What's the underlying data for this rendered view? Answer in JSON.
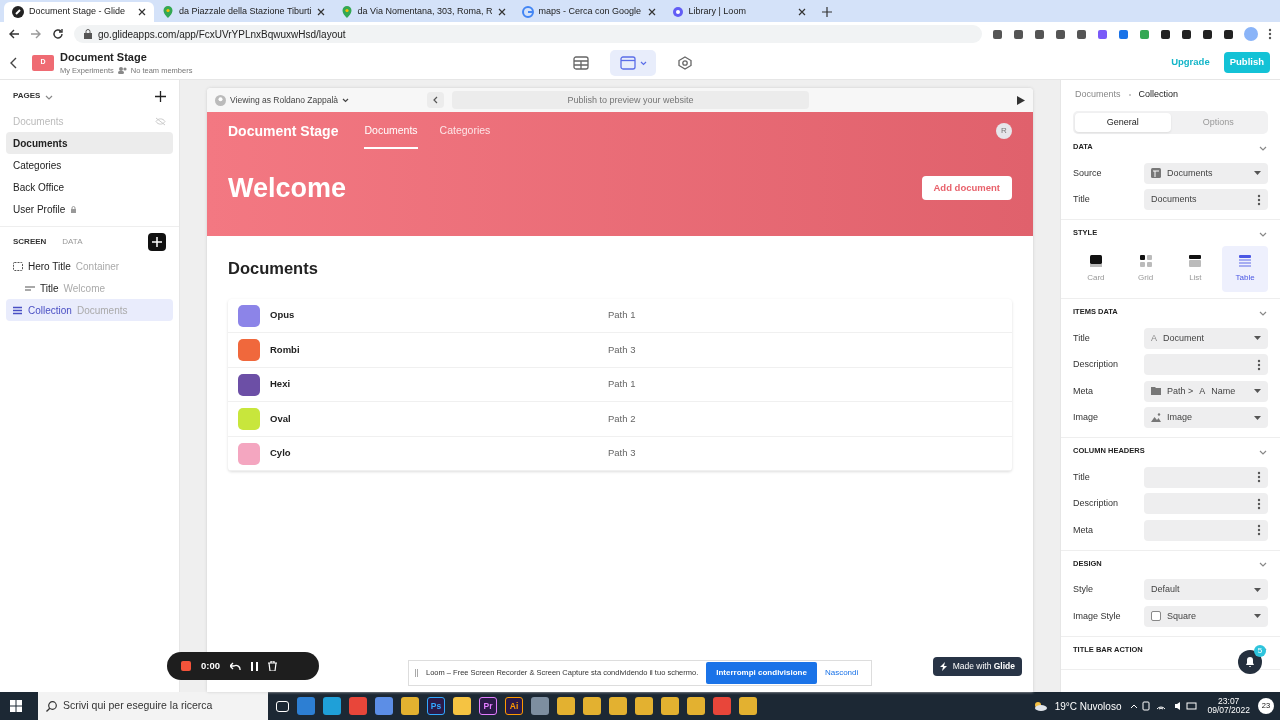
{
  "browser": {
    "tabs": [
      {
        "title": "Document Stage - Glide",
        "kind": "glide",
        "selected": true
      },
      {
        "title": "da Piazzale della Stazione Tiburti",
        "kind": "maps",
        "selected": false
      },
      {
        "title": "da Via Nomentana, 303, Roma, R",
        "kind": "maps",
        "selected": false
      },
      {
        "title": "maps - Cerca con Google",
        "kind": "google",
        "selected": false
      },
      {
        "title": "Library | Loom",
        "kind": "loom",
        "selected": false
      }
    ],
    "url": "go.glideapps.com/app/FcxUVrYPLnxBqwuxwHsd/layout"
  },
  "app_header": {
    "avatar_letter": "D",
    "title": "Document Stage",
    "subtitle": "My Experiments",
    "team": "No team members",
    "upgrade": "Upgrade",
    "publish": "Publish",
    "views": [
      {
        "kind": "data",
        "selected": false
      },
      {
        "kind": "layout",
        "selected": true
      },
      {
        "kind": "settings",
        "selected": false
      }
    ]
  },
  "pages": {
    "heading": "PAGES",
    "items": [
      {
        "label": "Documents",
        "hidden": true,
        "locked": false,
        "selected": false
      },
      {
        "label": "Documents",
        "hidden": false,
        "locked": false,
        "selected": true
      },
      {
        "label": "Categories",
        "hidden": false,
        "locked": false,
        "selected": false
      },
      {
        "label": "Back Office",
        "hidden": false,
        "locked": false,
        "selected": false
      },
      {
        "label": "User Profile",
        "hidden": false,
        "locked": true,
        "selected": false
      }
    ]
  },
  "screen_tabs": [
    {
      "label": "SCREEN",
      "selected": true
    },
    {
      "label": "DATA",
      "selected": false
    }
  ],
  "components": [
    {
      "name": "Hero Title",
      "detail": "Container",
      "kind": "container",
      "selected": false,
      "children": [
        {
          "name": "Title",
          "detail": "Welcome",
          "kind": "title",
          "selected": false
        }
      ]
    },
    {
      "name": "Collection",
      "detail": "Documents",
      "kind": "collection",
      "selected": true
    }
  ],
  "preview": {
    "viewing_as": "Viewing as Roldano Zappalà",
    "url_placeholder": "Publish to preview your website",
    "app_title": "Document Stage",
    "nav": [
      {
        "label": "Documents",
        "selected": true
      },
      {
        "label": "Categories",
        "selected": false
      }
    ],
    "user_initial": "R",
    "hero_title": "Welcome",
    "hero_button": "Add document",
    "section_title": "Documents",
    "rows": [
      {
        "title": "Opus",
        "meta": "Path 1",
        "color": "#8c84e8"
      },
      {
        "title": "Rombi",
        "meta": "Path 3",
        "color": "#f0683c"
      },
      {
        "title": "Hexi",
        "meta": "Path 1",
        "color": "#6c4fa6"
      },
      {
        "title": "Oval",
        "meta": "Path 2",
        "color": "#c8e63c"
      },
      {
        "title": "Cylo",
        "meta": "Path 3",
        "color": "#f4a6c0"
      }
    ],
    "made_with": "Made with **Glide**"
  },
  "inspector": {
    "breadcrumb": [
      "Documents",
      "Collection"
    ],
    "tabs": [
      {
        "label": "General",
        "selected": true
      },
      {
        "label": "Options",
        "selected": false
      }
    ],
    "sections": [
      {
        "title": "DATA",
        "kind": "fields",
        "fields": [
          {
            "label": "Source",
            "kind": "table-select",
            "tokens": [
              "Documents"
            ]
          },
          {
            "label": "Title",
            "kind": "menu",
            "tokens": [
              "Documents"
            ]
          }
        ]
      },
      {
        "title": "STYLE",
        "kind": "styles",
        "options": [
          {
            "label": "Card",
            "selected": false
          },
          {
            "label": "Grid",
            "selected": false
          },
          {
            "label": "List",
            "selected": false
          },
          {
            "label": "Table",
            "selected": true
          }
        ]
      },
      {
        "title": "ITEMS DATA",
        "kind": "fields",
        "fields": [
          {
            "label": "Title",
            "kind": "select",
            "tokens": [
              "A",
              "Document"
            ]
          },
          {
            "label": "Description",
            "kind": "menu"
          },
          {
            "label": "Meta",
            "kind": "folder-select",
            "tokens": [
              "Path >",
              "A",
              "Name"
            ]
          },
          {
            "label": "Image",
            "kind": "image-select",
            "tokens": [
              "Image"
            ]
          }
        ]
      },
      {
        "title": "COLUMN HEADERS",
        "kind": "fields",
        "fields": [
          {
            "label": "Title",
            "kind": "menu"
          },
          {
            "label": "Description",
            "kind": "menu"
          },
          {
            "label": "Meta",
            "kind": "menu"
          }
        ]
      },
      {
        "title": "DESIGN",
        "kind": "fields",
        "fields": [
          {
            "label": "Style",
            "kind": "select",
            "tokens": [
              "Default"
            ]
          },
          {
            "label": "Image Style",
            "kind": "checkbox-select",
            "tokens": [
              "Square"
            ]
          }
        ]
      },
      {
        "title": "TITLE BAR ACTION",
        "kind": "fields"
      }
    ],
    "notification_count": "5"
  },
  "loom": {
    "timer": "0:00",
    "message": "Loom – Free Screen Recorder & Screen Capture sta condividendo il tuo schermo.",
    "stop": "Interrompi condivisione",
    "hide": "Nascondi"
  },
  "taskbar": {
    "search": "Scrivi qui per eseguire la ricerca",
    "apps": [
      {
        "kind": "view"
      },
      {
        "kind": "mail"
      },
      {
        "kind": "edge"
      },
      {
        "kind": "chrome"
      },
      {
        "kind": "store"
      },
      {
        "kind": "app"
      },
      {
        "kind": "label",
        "label": "Ps"
      },
      {
        "kind": "folder"
      },
      {
        "kind": "label",
        "label": "Pr"
      },
      {
        "kind": "label",
        "label": "Ai"
      },
      {
        "kind": "camera"
      },
      {
        "kind": "app"
      },
      {
        "kind": "app"
      },
      {
        "kind": "app"
      },
      {
        "kind": "app"
      },
      {
        "kind": "app"
      },
      {
        "kind": "app"
      },
      {
        "kind": "chrome"
      },
      {
        "kind": "app"
      }
    ],
    "weather": "19°C Nuvoloso",
    "time": "23:07",
    "date": "09/07/2022",
    "notifications": "23"
  }
}
